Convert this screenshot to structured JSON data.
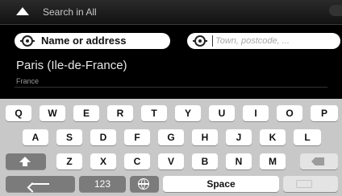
{
  "topbar": {
    "title": "Search in All"
  },
  "search": {
    "name_label": "Name or address",
    "town_placeholder": "Town, postcode, ..."
  },
  "result": {
    "name": "Paris (Ile-de-France)",
    "country": "France"
  },
  "keyboard": {
    "row1": [
      "Q",
      "W",
      "E",
      "R",
      "T",
      "Y",
      "U",
      "I",
      "O",
      "P"
    ],
    "row2": [
      "A",
      "S",
      "D",
      "F",
      "G",
      "H",
      "J",
      "K",
      "L"
    ],
    "row3": [
      "Z",
      "X",
      "C",
      "V",
      "B",
      "N",
      "M"
    ],
    "numbers_label": "123",
    "space_label": "Space"
  },
  "colors": {
    "background": "#000000",
    "keyboard": "#c8c8c8",
    "key": "#ffffff",
    "dark_key": "#7b7b7b"
  },
  "icons": [
    "up-arrow-icon",
    "target-icon",
    "shift-icon",
    "backspace-icon",
    "back-arrow-icon",
    "globe-icon",
    "keyboard-icon"
  ]
}
